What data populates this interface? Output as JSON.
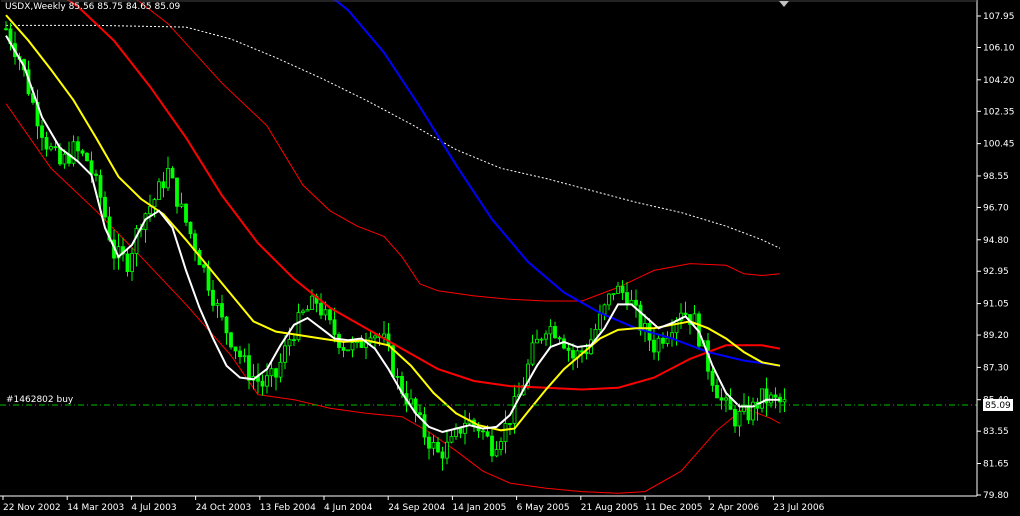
{
  "header": {
    "symbol": "USDX,Weekly",
    "ohlc": "85.56 85.75 84.65 85.09"
  },
  "order_line": {
    "label": "#1462802 buy",
    "price": 85.09,
    "color": "#00c000"
  },
  "current_price_label": "85.09",
  "colors": {
    "background": "#000000",
    "candles": "#00ff00",
    "ma_fast": "#ffffff",
    "ma_medium": "#ffff00",
    "ma_slow": "#ff0000",
    "ma_long": "#0000ff",
    "bands": "#ff0000",
    "ma_very_long": "#ffffff",
    "axis": "#ffffff"
  },
  "chart_data": {
    "type": "candlestick",
    "ylim": [
      79.8,
      108.5
    ],
    "y_ticks": [
      "107.95",
      "106.10",
      "104.20",
      "102.35",
      "100.45",
      "98.55",
      "96.70",
      "94.80",
      "92.95",
      "91.05",
      "89.20",
      "87.30",
      "85.40",
      "83.55",
      "81.65",
      "79.80"
    ],
    "x_ticks": [
      "22 Nov 2002",
      "14 Mar 2003",
      "4 Jul 2003",
      "24 Oct 2003",
      "13 Feb 2004",
      "4 Jun 2004",
      "24 Sep 2004",
      "14 Jan 2005",
      "6 May 2005",
      "21 Aug 2005",
      "11 Dec 2005",
      "2 Apr 2006",
      "23 Jul 2006"
    ],
    "close_path": [
      [
        0,
        107.2
      ],
      [
        3,
        105.5
      ],
      [
        6,
        102.8
      ],
      [
        9,
        100.5
      ],
      [
        12,
        99.2
      ],
      [
        15,
        100.1
      ],
      [
        18,
        99.5
      ],
      [
        21,
        97.3
      ],
      [
        24,
        94.0
      ],
      [
        27,
        93.5
      ],
      [
        30,
        96.0
      ],
      [
        33,
        97.2
      ],
      [
        36,
        98.8
      ],
      [
        39,
        96.5
      ],
      [
        42,
        94.5
      ],
      [
        45,
        92.3
      ],
      [
        48,
        90.0
      ],
      [
        51,
        88.5
      ],
      [
        54,
        87.0
      ],
      [
        57,
        86.3
      ],
      [
        60,
        86.8
      ],
      [
        63,
        89.0
      ],
      [
        66,
        90.4
      ],
      [
        69,
        91.2
      ],
      [
        72,
        89.7
      ],
      [
        75,
        88.6
      ],
      [
        78,
        88.4
      ],
      [
        81,
        89.6
      ],
      [
        84,
        88.8
      ],
      [
        87,
        86.5
      ],
      [
        90,
        85.1
      ],
      [
        93,
        83.4
      ],
      [
        96,
        82.2
      ],
      [
        99,
        82.8
      ],
      [
        102,
        84.2
      ],
      [
        105,
        83.8
      ],
      [
        108,
        82.7
      ],
      [
        111,
        83.8
      ],
      [
        114,
        85.6
      ],
      [
        117,
        88.2
      ],
      [
        120,
        89.8
      ],
      [
        123,
        89.4
      ],
      [
        126,
        87.9
      ],
      [
        129,
        88.4
      ],
      [
        132,
        90.1
      ],
      [
        135,
        91.9
      ],
      [
        138,
        91.6
      ],
      [
        141,
        89.8
      ],
      [
        144,
        88.6
      ],
      [
        147,
        89.5
      ],
      [
        150,
        90.8
      ],
      [
        153,
        90.0
      ],
      [
        156,
        87.4
      ],
      [
        159,
        85.3
      ],
      [
        162,
        84.3
      ],
      [
        165,
        84.6
      ],
      [
        168,
        85.5
      ],
      [
        171,
        85.3
      ],
      [
        173,
        85.1
      ]
    ],
    "indicators": {
      "ma_fast": [
        [
          0,
          106.8
        ],
        [
          4,
          105.0
        ],
        [
          8,
          102.0
        ],
        [
          12,
          100.2
        ],
        [
          16,
          99.4
        ],
        [
          19,
          98.6
        ],
        [
          22,
          95.5
        ],
        [
          25,
          93.8
        ],
        [
          28,
          94.5
        ],
        [
          31,
          96.0
        ],
        [
          34,
          96.5
        ],
        [
          37,
          95.5
        ],
        [
          40,
          93.0
        ],
        [
          43,
          90.8
        ],
        [
          46,
          89.0
        ],
        [
          49,
          87.4
        ],
        [
          52,
          86.7
        ],
        [
          55,
          86.6
        ],
        [
          58,
          87.2
        ],
        [
          61,
          88.6
        ],
        [
          64,
          89.8
        ],
        [
          67,
          90.2
        ],
        [
          70,
          89.6
        ],
        [
          73,
          89.0
        ],
        [
          76,
          88.9
        ],
        [
          79,
          89.0
        ],
        [
          82,
          88.4
        ],
        [
          85,
          87.2
        ],
        [
          88,
          85.8
        ],
        [
          91,
          84.6
        ],
        [
          94,
          83.8
        ],
        [
          97,
          83.5
        ],
        [
          100,
          83.7
        ],
        [
          103,
          83.9
        ],
        [
          106,
          83.7
        ],
        [
          109,
          83.8
        ],
        [
          112,
          84.5
        ],
        [
          115,
          86.0
        ],
        [
          118,
          87.4
        ],
        [
          121,
          88.5
        ],
        [
          124,
          88.8
        ],
        [
          127,
          88.5
        ],
        [
          130,
          88.6
        ],
        [
          133,
          89.6
        ],
        [
          136,
          91.0
        ],
        [
          139,
          91.0
        ],
        [
          142,
          90.3
        ],
        [
          145,
          89.6
        ],
        [
          148,
          89.9
        ],
        [
          151,
          90.3
        ],
        [
          154,
          89.4
        ],
        [
          157,
          87.4
        ],
        [
          160,
          85.8
        ],
        [
          163,
          85.0
        ],
        [
          166,
          85.0
        ],
        [
          169,
          85.4
        ],
        [
          172,
          85.4
        ]
      ],
      "ma_medium": [
        [
          0,
          108.0
        ],
        [
          5,
          106.5
        ],
        [
          10,
          104.8
        ],
        [
          15,
          103.0
        ],
        [
          20,
          100.8
        ],
        [
          25,
          98.5
        ],
        [
          30,
          97.2
        ],
        [
          35,
          96.3
        ],
        [
          40,
          94.8
        ],
        [
          45,
          93.2
        ],
        [
          50,
          91.6
        ],
        [
          55,
          90.0
        ],
        [
          60,
          89.4
        ],
        [
          65,
          89.2
        ],
        [
          70,
          89.0
        ],
        [
          75,
          88.8
        ],
        [
          80,
          88.9
        ],
        [
          85,
          88.6
        ],
        [
          90,
          87.4
        ],
        [
          95,
          85.8
        ],
        [
          100,
          84.6
        ],
        [
          105,
          83.9
        ],
        [
          110,
          83.6
        ],
        [
          113,
          83.7
        ],
        [
          116,
          84.7
        ],
        [
          120,
          86.0
        ],
        [
          124,
          87.2
        ],
        [
          128,
          88.1
        ],
        [
          132,
          89.0
        ],
        [
          136,
          89.5
        ],
        [
          140,
          89.6
        ],
        [
          144,
          89.6
        ],
        [
          148,
          89.8
        ],
        [
          152,
          90.0
        ],
        [
          156,
          89.6
        ],
        [
          160,
          89.0
        ],
        [
          164,
          88.2
        ],
        [
          168,
          87.6
        ],
        [
          172,
          87.4
        ]
      ],
      "ma_slow": [
        [
          0,
          112.0
        ],
        [
          8,
          110.5
        ],
        [
          16,
          108.5
        ],
        [
          24,
          106.5
        ],
        [
          32,
          103.8
        ],
        [
          40,
          100.8
        ],
        [
          48,
          97.4
        ],
        [
          56,
          94.6
        ],
        [
          64,
          92.5
        ],
        [
          72,
          90.8
        ],
        [
          80,
          89.6
        ],
        [
          88,
          88.4
        ],
        [
          96,
          87.2
        ],
        [
          104,
          86.5
        ],
        [
          112,
          86.2
        ],
        [
          120,
          86.1
        ],
        [
          128,
          86.0
        ],
        [
          136,
          86.1
        ],
        [
          144,
          86.7
        ],
        [
          152,
          87.8
        ],
        [
          160,
          88.6
        ],
        [
          168,
          88.6
        ],
        [
          172,
          88.4
        ]
      ],
      "ma_long": [
        [
          60,
          112.0
        ],
        [
          68,
          110.3
        ],
        [
          76,
          108.3
        ],
        [
          84,
          105.8
        ],
        [
          92,
          102.6
        ],
        [
          100,
          99.2
        ],
        [
          108,
          96.0
        ],
        [
          116,
          93.5
        ],
        [
          124,
          91.7
        ],
        [
          132,
          90.5
        ],
        [
          140,
          89.6
        ],
        [
          148,
          89.0
        ],
        [
          156,
          88.2
        ],
        [
          164,
          87.7
        ],
        [
          172,
          87.4
        ]
      ],
      "ma_very_long": [
        [
          0,
          107.4
        ],
        [
          20,
          107.4
        ],
        [
          40,
          107.3
        ],
        [
          50,
          106.6
        ],
        [
          60,
          105.5
        ],
        [
          70,
          104.3
        ],
        [
          80,
          103.0
        ],
        [
          90,
          101.6
        ],
        [
          100,
          100.1
        ],
        [
          110,
          99.0
        ],
        [
          120,
          98.4
        ],
        [
          130,
          97.7
        ],
        [
          140,
          97.0
        ],
        [
          150,
          96.4
        ],
        [
          160,
          95.6
        ],
        [
          168,
          94.8
        ],
        [
          172,
          94.3
        ]
      ],
      "band_upper": [
        [
          0,
          116.0
        ],
        [
          24,
          110.0
        ],
        [
          36,
          107.5
        ],
        [
          48,
          104.0
        ],
        [
          58,
          101.5
        ],
        [
          66,
          98.0
        ],
        [
          72,
          96.5
        ],
        [
          78,
          95.6
        ],
        [
          84,
          95.0
        ],
        [
          88,
          93.8
        ],
        [
          92,
          92.2
        ],
        [
          96,
          91.8
        ],
        [
          104,
          91.5
        ],
        [
          112,
          91.3
        ],
        [
          120,
          91.2
        ],
        [
          128,
          91.2
        ],
        [
          136,
          92.0
        ],
        [
          144,
          93.0
        ],
        [
          152,
          93.4
        ],
        [
          160,
          93.3
        ],
        [
          164,
          92.8
        ],
        [
          168,
          92.7
        ],
        [
          172,
          92.8
        ]
      ],
      "band_lower": [
        [
          0,
          102.8
        ],
        [
          10,
          99.0
        ],
        [
          20,
          96.5
        ],
        [
          30,
          93.8
        ],
        [
          40,
          91.0
        ],
        [
          50,
          88.0
        ],
        [
          56,
          85.7
        ],
        [
          64,
          85.4
        ],
        [
          72,
          84.9
        ],
        [
          80,
          84.6
        ],
        [
          88,
          84.4
        ],
        [
          94,
          83.5
        ],
        [
          100,
          82.4
        ],
        [
          106,
          81.2
        ],
        [
          112,
          80.5
        ],
        [
          120,
          80.2
        ],
        [
          128,
          80.0
        ],
        [
          136,
          79.9
        ],
        [
          142,
          80.0
        ],
        [
          150,
          81.2
        ],
        [
          158,
          83.6
        ],
        [
          164,
          84.9
        ],
        [
          170,
          84.3
        ],
        [
          172,
          84.0
        ]
      ]
    }
  }
}
